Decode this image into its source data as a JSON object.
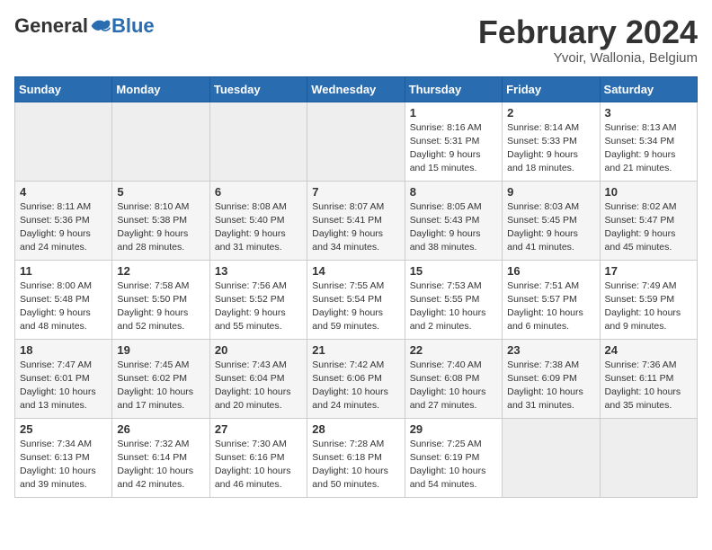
{
  "header": {
    "logo": {
      "general": "General",
      "blue": "Blue",
      "tagline": ""
    },
    "title": "February 2024",
    "location": "Yvoir, Wallonia, Belgium"
  },
  "weekdays": [
    "Sunday",
    "Monday",
    "Tuesday",
    "Wednesday",
    "Thursday",
    "Friday",
    "Saturday"
  ],
  "weeks": [
    [
      {
        "day": "",
        "info": ""
      },
      {
        "day": "",
        "info": ""
      },
      {
        "day": "",
        "info": ""
      },
      {
        "day": "",
        "info": ""
      },
      {
        "day": "1",
        "info": "Sunrise: 8:16 AM\nSunset: 5:31 PM\nDaylight: 9 hours\nand 15 minutes."
      },
      {
        "day": "2",
        "info": "Sunrise: 8:14 AM\nSunset: 5:33 PM\nDaylight: 9 hours\nand 18 minutes."
      },
      {
        "day": "3",
        "info": "Sunrise: 8:13 AM\nSunset: 5:34 PM\nDaylight: 9 hours\nand 21 minutes."
      }
    ],
    [
      {
        "day": "4",
        "info": "Sunrise: 8:11 AM\nSunset: 5:36 PM\nDaylight: 9 hours\nand 24 minutes."
      },
      {
        "day": "5",
        "info": "Sunrise: 8:10 AM\nSunset: 5:38 PM\nDaylight: 9 hours\nand 28 minutes."
      },
      {
        "day": "6",
        "info": "Sunrise: 8:08 AM\nSunset: 5:40 PM\nDaylight: 9 hours\nand 31 minutes."
      },
      {
        "day": "7",
        "info": "Sunrise: 8:07 AM\nSunset: 5:41 PM\nDaylight: 9 hours\nand 34 minutes."
      },
      {
        "day": "8",
        "info": "Sunrise: 8:05 AM\nSunset: 5:43 PM\nDaylight: 9 hours\nand 38 minutes."
      },
      {
        "day": "9",
        "info": "Sunrise: 8:03 AM\nSunset: 5:45 PM\nDaylight: 9 hours\nand 41 minutes."
      },
      {
        "day": "10",
        "info": "Sunrise: 8:02 AM\nSunset: 5:47 PM\nDaylight: 9 hours\nand 45 minutes."
      }
    ],
    [
      {
        "day": "11",
        "info": "Sunrise: 8:00 AM\nSunset: 5:48 PM\nDaylight: 9 hours\nand 48 minutes."
      },
      {
        "day": "12",
        "info": "Sunrise: 7:58 AM\nSunset: 5:50 PM\nDaylight: 9 hours\nand 52 minutes."
      },
      {
        "day": "13",
        "info": "Sunrise: 7:56 AM\nSunset: 5:52 PM\nDaylight: 9 hours\nand 55 minutes."
      },
      {
        "day": "14",
        "info": "Sunrise: 7:55 AM\nSunset: 5:54 PM\nDaylight: 9 hours\nand 59 minutes."
      },
      {
        "day": "15",
        "info": "Sunrise: 7:53 AM\nSunset: 5:55 PM\nDaylight: 10 hours\nand 2 minutes."
      },
      {
        "day": "16",
        "info": "Sunrise: 7:51 AM\nSunset: 5:57 PM\nDaylight: 10 hours\nand 6 minutes."
      },
      {
        "day": "17",
        "info": "Sunrise: 7:49 AM\nSunset: 5:59 PM\nDaylight: 10 hours\nand 9 minutes."
      }
    ],
    [
      {
        "day": "18",
        "info": "Sunrise: 7:47 AM\nSunset: 6:01 PM\nDaylight: 10 hours\nand 13 minutes."
      },
      {
        "day": "19",
        "info": "Sunrise: 7:45 AM\nSunset: 6:02 PM\nDaylight: 10 hours\nand 17 minutes."
      },
      {
        "day": "20",
        "info": "Sunrise: 7:43 AM\nSunset: 6:04 PM\nDaylight: 10 hours\nand 20 minutes."
      },
      {
        "day": "21",
        "info": "Sunrise: 7:42 AM\nSunset: 6:06 PM\nDaylight: 10 hours\nand 24 minutes."
      },
      {
        "day": "22",
        "info": "Sunrise: 7:40 AM\nSunset: 6:08 PM\nDaylight: 10 hours\nand 27 minutes."
      },
      {
        "day": "23",
        "info": "Sunrise: 7:38 AM\nSunset: 6:09 PM\nDaylight: 10 hours\nand 31 minutes."
      },
      {
        "day": "24",
        "info": "Sunrise: 7:36 AM\nSunset: 6:11 PM\nDaylight: 10 hours\nand 35 minutes."
      }
    ],
    [
      {
        "day": "25",
        "info": "Sunrise: 7:34 AM\nSunset: 6:13 PM\nDaylight: 10 hours\nand 39 minutes."
      },
      {
        "day": "26",
        "info": "Sunrise: 7:32 AM\nSunset: 6:14 PM\nDaylight: 10 hours\nand 42 minutes."
      },
      {
        "day": "27",
        "info": "Sunrise: 7:30 AM\nSunset: 6:16 PM\nDaylight: 10 hours\nand 46 minutes."
      },
      {
        "day": "28",
        "info": "Sunrise: 7:28 AM\nSunset: 6:18 PM\nDaylight: 10 hours\nand 50 minutes."
      },
      {
        "day": "29",
        "info": "Sunrise: 7:25 AM\nSunset: 6:19 PM\nDaylight: 10 hours\nand 54 minutes."
      },
      {
        "day": "",
        "info": ""
      },
      {
        "day": "",
        "info": ""
      }
    ]
  ]
}
